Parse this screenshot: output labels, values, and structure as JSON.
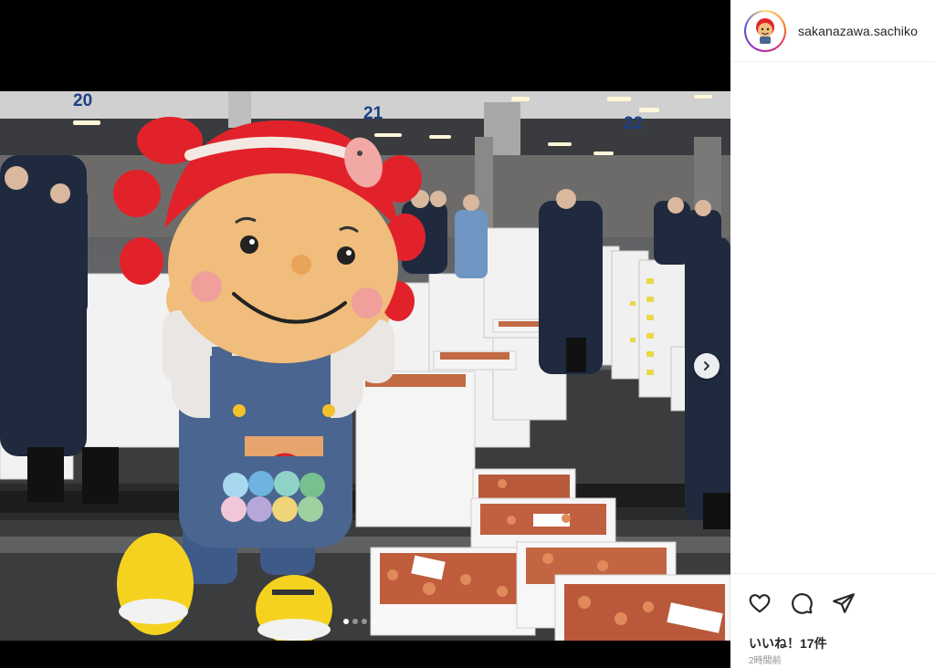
{
  "post": {
    "username": "sakanazawa.sachiko",
    "likes_text": "いいね！17件",
    "timestamp": "2時間前",
    "gate_numbers": [
      "20",
      "21",
      "22"
    ],
    "carousel": {
      "total": 4,
      "active_index": 0
    }
  },
  "icons": {
    "like": "heart-icon",
    "comment": "comment-icon",
    "share": "paper-plane-icon",
    "next": "chevron-right-icon"
  },
  "colors": {
    "mascot_hair": "#e2222b",
    "mascot_face": "#f0bd7c",
    "overalls": "#4a6690",
    "crab": "#c06040",
    "crate": "#f4f4f4",
    "gate_number": "#1d3f86",
    "username_text": "#262626",
    "muted_text": "#8e8e8e"
  }
}
